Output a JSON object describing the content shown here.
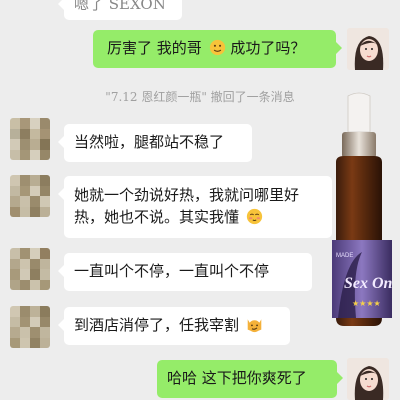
{
  "messages": {
    "m0": "嗯了 SEXON",
    "m1": "厉害了  我的哥",
    "m1b": "  成功了吗？",
    "recall": "\"7.12 恩红颜一瓶\" 撤回了一条消息",
    "m2": "当然啦，腿都站不稳了",
    "m3a": "她就一个劲说好热，我就问哪里好",
    "m3b": "热，她也不说。其实我懂",
    "m4": "一直叫个不停，一直叫个不停",
    "m5": "到酒店消停了，任我宰割",
    "m6": "哈哈  这下把你爽死了"
  },
  "product": {
    "label_text": "Sex On",
    "label_small": "MADE"
  },
  "colors": {
    "background": "#ededed",
    "incoming_bubble": "#ffffff",
    "outgoing_bubble": "#95ec69"
  },
  "icons": [
    "grin-emoji-icon",
    "victory-emoji-icon",
    "blush-emoji-icon",
    "smirk-cat-emoji-icon"
  ]
}
